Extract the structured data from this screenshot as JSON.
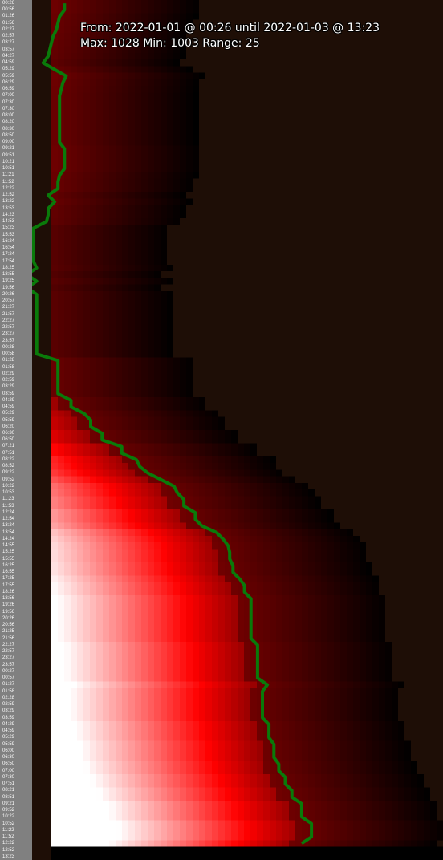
{
  "header": {
    "line1": "From: 2022-01-01 @ 00:26 until 2022-01-03 @ 13:23",
    "line2": "Max: 1028 Min: 1003 Range: 25"
  },
  "chart_data": {
    "type": "heatmap",
    "y_axis_labels": [
      "00:26",
      "00:56",
      "01:26",
      "01:56",
      "02:27",
      "02:57",
      "03:27",
      "03:57",
      "04:27",
      "04:59",
      "05:29",
      "05:59",
      "06:29",
      "06:59",
      "07:00",
      "07:30",
      "07:30",
      "08:00",
      "08:20",
      "08:30",
      "08:50",
      "09:00",
      "09:21",
      "09:51",
      "10:21",
      "10:51",
      "11:21",
      "11:52",
      "12:22",
      "12:52",
      "13:22",
      "13:53",
      "14:23",
      "14:53",
      "15:23",
      "15:53",
      "16:24",
      "16:54",
      "17:24",
      "17:54",
      "18:25",
      "18:55",
      "19:25",
      "19:56",
      "20:26",
      "20:57",
      "21:27",
      "21:57",
      "22:27",
      "22:57",
      "23:27",
      "23:57",
      "00:28",
      "00:58",
      "01:28",
      "01:58",
      "02:29",
      "02:59",
      "03:29",
      "03:59",
      "04:29",
      "04:59",
      "05:29",
      "05:59",
      "06:20",
      "06:30",
      "06:50",
      "07:21",
      "07:51",
      "08:22",
      "08:52",
      "09:22",
      "09:52",
      "10:22",
      "10:53",
      "11:23",
      "11:53",
      "12:24",
      "12:54",
      "13:24",
      "13:54",
      "14:24",
      "14:55",
      "15:25",
      "15:55",
      "16:25",
      "16:55",
      "17:25",
      "17:55",
      "18:26",
      "18:56",
      "19:26",
      "19:56",
      "20:26",
      "20:56",
      "21:25",
      "21:56",
      "22:27",
      "22:57",
      "23:27",
      "23:57",
      "00:27",
      "00:57",
      "01:27",
      "01:58",
      "02:28",
      "02:59",
      "03:29",
      "03:59",
      "04:29",
      "04:59",
      "05:29",
      "05:59",
      "06:00",
      "06:30",
      "06:50",
      "07:00",
      "07:30",
      "07:51",
      "08:21",
      "08:51",
      "09:21",
      "09:52",
      "10:22",
      "10:52",
      "11:22",
      "11:52",
      "12:22",
      "12:52",
      "13:23"
    ],
    "value_range": {
      "min": 1003,
      "max": 1028,
      "range": 25
    },
    "colors": {
      "low": "#000000",
      "mid": "#ff0000",
      "high": "#ffffff",
      "lowest_column": "#1e0e06",
      "time_strip": "#808080",
      "trace": "#0a7a0a"
    },
    "trace": {
      "name": "pressure",
      "values": [
        1003.9,
        1003.9,
        1003.6,
        1003.5,
        1003.4,
        1003.2,
        1003.1,
        1003.0,
        1002.9,
        1002.6,
        1003.3,
        1004.0,
        1003.8,
        1003.7,
        1003.6,
        1003.6,
        1003.6,
        1003.6,
        1003.6,
        1003.6,
        1003.6,
        1003.6,
        1003.9,
        1003.9,
        1003.9,
        1003.9,
        1003.6,
        1003.5,
        1003.5,
        1002.9,
        1003.3,
        1002.9,
        1002.9,
        1002.8,
        1002.0,
        1002.0,
        1002.0,
        1002.0,
        1002.0,
        1002.0,
        1002.2,
        1001.6,
        1002.2,
        1001.6,
        1002.2,
        1002.2,
        1002.2,
        1002.2,
        1002.2,
        1002.2,
        1002.2,
        1002.2,
        1002.2,
        1002.2,
        1003.5,
        1003.5,
        1003.5,
        1003.5,
        1003.5,
        1003.5,
        1004.3,
        1004.3,
        1005.1,
        1005.5,
        1005.5,
        1006.2,
        1006.2,
        1007.4,
        1007.4,
        1008.3,
        1008.5,
        1009.0,
        1009.8,
        1010.6,
        1010.8,
        1011.2,
        1011.2,
        1011.9,
        1011.9,
        1012.3,
        1013.2,
        1013.6,
        1013.9,
        1014.0,
        1014.0,
        1014.2,
        1014.2,
        1014.6,
        1014.9,
        1014.9,
        1015.3,
        1015.3,
        1015.3,
        1015.3,
        1015.3,
        1015.3,
        1015.3,
        1015.7,
        1015.7,
        1015.7,
        1015.7,
        1015.7,
        1015.7,
        1016.3,
        1016.0,
        1016.0,
        1016.0,
        1016.0,
        1016.0,
        1016.4,
        1016.4,
        1016.4,
        1016.7,
        1016.7,
        1016.7,
        1017.0,
        1017.0,
        1017.4,
        1017.4,
        1017.8,
        1017.8,
        1018.4,
        1018.4,
        1018.4,
        1019.0,
        1019.0,
        1019.0,
        1018.4
      ]
    }
  }
}
